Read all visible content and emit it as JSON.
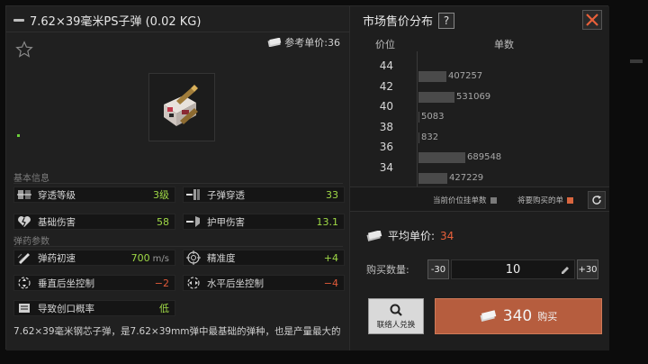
{
  "item": {
    "title": "7.62×39毫米PS子弹 (0.02 KG)",
    "ref_price_label": "参考单价:36",
    "description": "7.62×39毫米钢芯子弹，是7.62×39mm弹中最基础的弹种，也是产量最大的"
  },
  "sections": {
    "basic": "基本信息",
    "ammo": "弹药参数"
  },
  "stats": [
    {
      "label": "穿透等级",
      "value": "3级",
      "icon": "penetration-level-icon",
      "color": "green"
    },
    {
      "label": "子弹穿透",
      "value": "33",
      "icon": "bullet-penetration-icon",
      "color": "green"
    },
    {
      "label": "基础伤害",
      "value": "58",
      "icon": "broken-heart-icon",
      "color": "green"
    },
    {
      "label": "护甲伤害",
      "value": "13.1",
      "icon": "armor-damage-icon",
      "color": "green"
    },
    {
      "label": "弹药初速",
      "value": "700",
      "unit": "m/s",
      "icon": "muzzle-velocity-icon",
      "color": "green"
    },
    {
      "label": "精准度",
      "value": "+4",
      "icon": "crosshair-icon",
      "color": "green"
    },
    {
      "label": "垂直后坐控制",
      "value": "−2",
      "icon": "vertical-recoil-icon",
      "color": "red"
    },
    {
      "label": "水平后坐控制",
      "value": "−4",
      "icon": "horizontal-recoil-icon",
      "color": "red"
    },
    {
      "label": "导致创口概率",
      "value": "低",
      "icon": "wound-chance-icon",
      "color": "green"
    }
  ],
  "market": {
    "title": "市场售价分布",
    "help": "?",
    "col_price": "价位",
    "col_qty": "单数",
    "legend_current": "当前价位挂单数",
    "legend_buy": "将要购买的单",
    "avg_label": "平均单价:",
    "avg_value": "34",
    "qty_label": "购买数量:",
    "minus": "-30",
    "plus": "+30",
    "qty_value": "10",
    "redeem_label": "联络人兑换",
    "buy_amount": "340",
    "buy_label": "购买",
    "colors": {
      "bar": "#4a4a4a",
      "buy": "#d9663f",
      "accent": "#e8603a"
    }
  },
  "chart_data": {
    "type": "bar",
    "orientation": "horizontal",
    "x_labels_visible": [
      "44",
      "42",
      "40",
      "38",
      "36",
      "34"
    ],
    "bars": [
      {
        "value": 407257
      },
      {
        "value": 531069
      },
      {
        "value": 5083
      },
      {
        "value": 832
      },
      {
        "value": 689548
      },
      {
        "value": 427229
      }
    ]
  }
}
